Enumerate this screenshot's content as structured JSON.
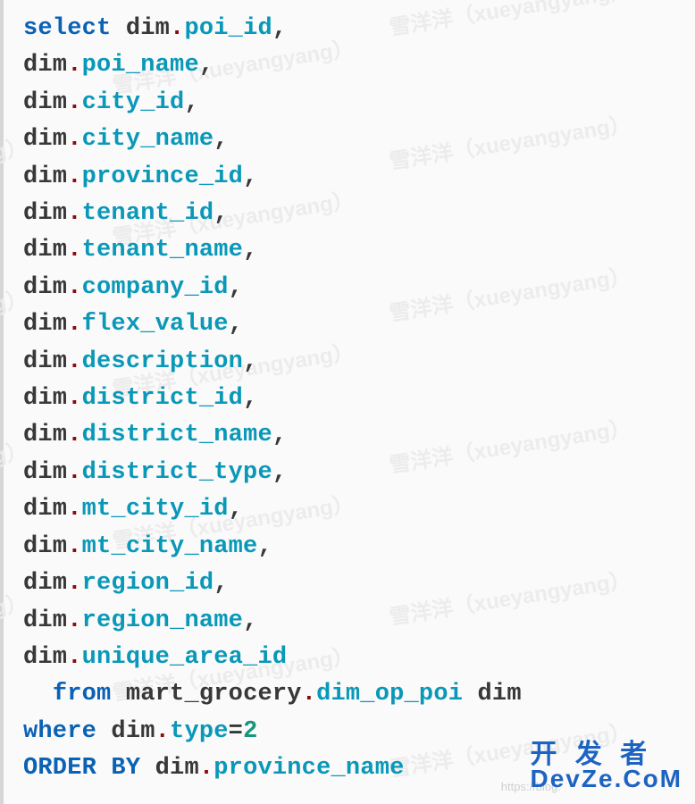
{
  "code": {
    "keyword_select": "select",
    "keyword_from": "from",
    "keyword_where": "where",
    "keyword_orderby": "ORDER BY",
    "alias": "dim",
    "schema": "mart_grocery",
    "table": "dim_op_poi",
    "where_col": "type",
    "where_val": "2",
    "orderby_col": "province_name",
    "columns": [
      "poi_id",
      "poi_name",
      "city_id",
      "city_name",
      "province_id",
      "tenant_id",
      "tenant_name",
      "company_id",
      "flex_value",
      "description",
      "district_id",
      "district_name",
      "district_type",
      "mt_city_id",
      "mt_city_name",
      "region_id",
      "region_name",
      "unique_area_id"
    ]
  },
  "watermark_text": "雪洋洋（xueyangyang）",
  "watermark_fragment": "ang）",
  "bottom_url": "https://blog.",
  "logo": {
    "line1": "开 发 者",
    "line2_a": "D",
    "line2_b": "ev",
    "line2_c": "Z",
    "line2_d": "e",
    "line2_e": ".C",
    "line2_f": "o",
    "line2_g": "M"
  }
}
